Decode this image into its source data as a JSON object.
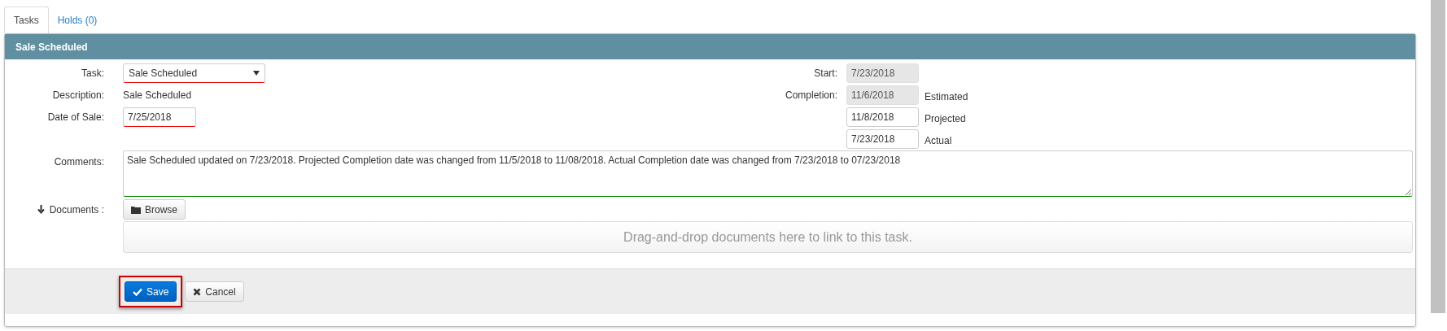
{
  "tabs": [
    {
      "label": "Tasks",
      "selected": true
    },
    {
      "label": "Holds (0)",
      "selected": false
    }
  ],
  "panel": {
    "title": "Sale Scheduled",
    "left_fields": [
      {
        "kind": "select",
        "label": "Task:",
        "value": "Sale Scheduled",
        "required": true
      },
      {
        "kind": "text",
        "label": "Description:",
        "value": "Sale Scheduled"
      },
      {
        "kind": "input",
        "label": "Date of Sale:",
        "value": "7/25/2018",
        "required": true
      }
    ],
    "right_fields": [
      {
        "label": "Start:",
        "value": "7/23/2018",
        "readonly": true
      },
      {
        "label": "Completion:",
        "value": "11/6/2018",
        "readonly": true,
        "suffix": "Estimated"
      },
      {
        "value": "11/8/2018",
        "readonly": false,
        "suffix": "Projected"
      },
      {
        "value": "7/23/2018",
        "readonly": false,
        "suffix": "Actual"
      }
    ],
    "comments": {
      "label": "Comments:",
      "value": "Sale Scheduled updated on 7/23/2018. Projected Completion date was changed from 11/5/2018 to 11/08/2018. Actual Completion date was changed from 7/23/2018 to 07/23/2018",
      "valid": true
    },
    "documents": {
      "label": "Documents :",
      "browse": "Browse",
      "dropzone": "Drag-and-drop documents here to link to this task."
    },
    "buttons": [
      {
        "kind": "primary",
        "label": "Save",
        "highlighted": true
      },
      {
        "kind": "default",
        "label": "Cancel",
        "highlighted": false
      }
    ]
  }
}
